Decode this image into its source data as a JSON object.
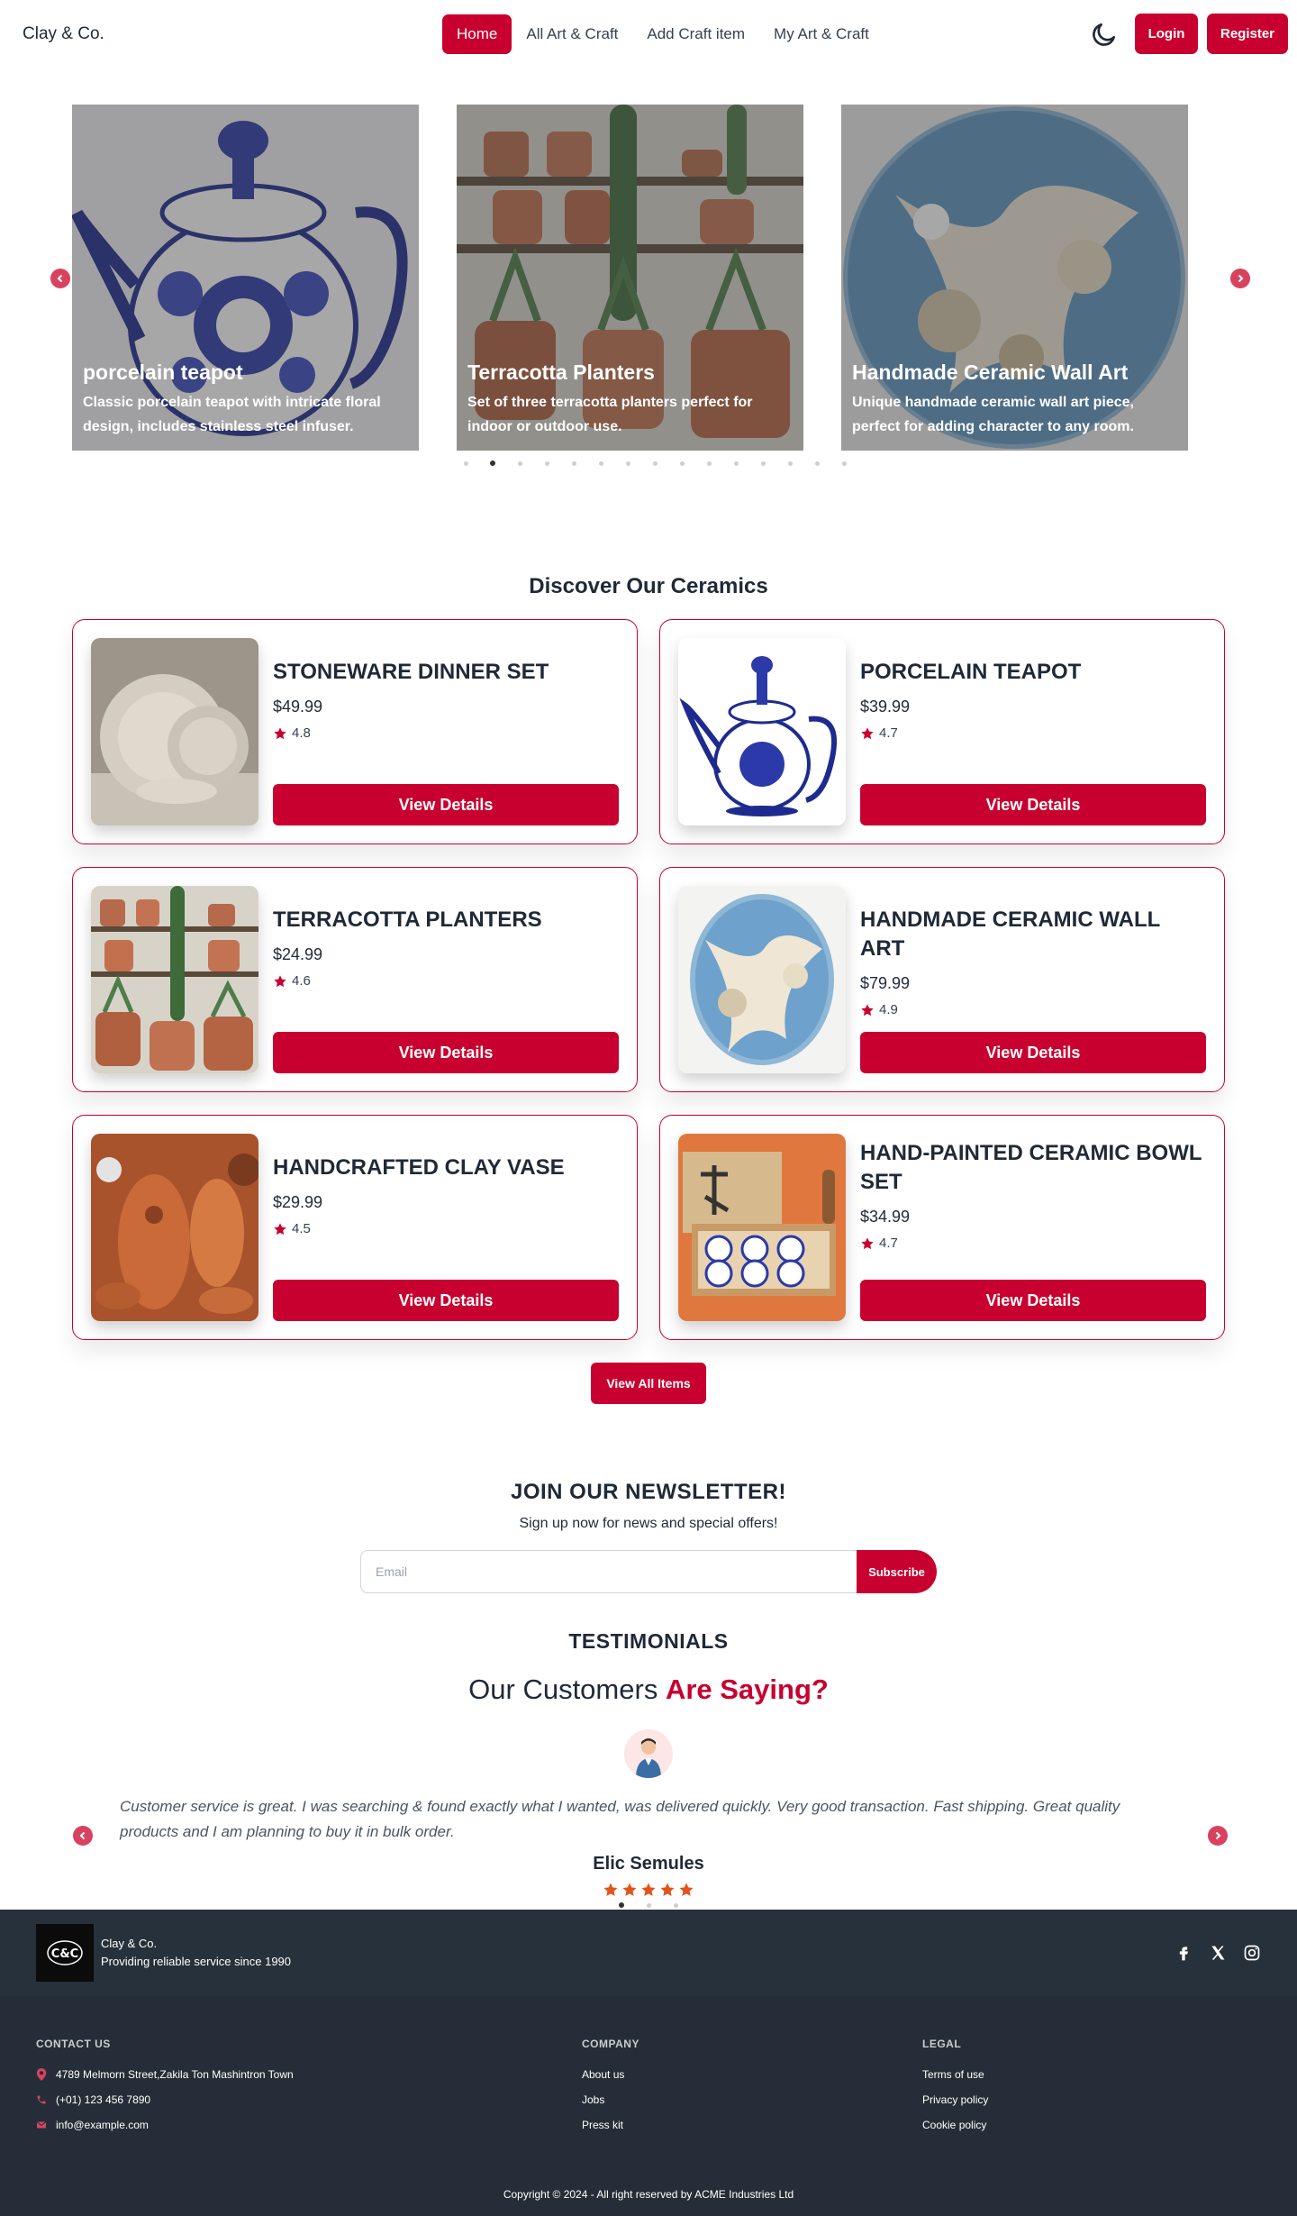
{
  "nav": {
    "brand": "Clay & Co.",
    "links": [
      "Home",
      "All Art & Craft",
      "Add Craft item",
      "My Art & Craft"
    ],
    "login": "Login",
    "register": "Register"
  },
  "carousel": {
    "slides": [
      {
        "title": "porcelain teapot",
        "desc": "Classic porcelain teapot with intricate floral design, includes stainless steel infuser."
      },
      {
        "title": "Terracotta Planters",
        "desc": "Set of three terracotta planters perfect for indoor or outdoor use."
      },
      {
        "title": "Handmade Ceramic Wall Art",
        "desc": "Unique handmade ceramic wall art piece, perfect for adding character to any room."
      }
    ],
    "dot_count": 15,
    "active_dot": 1
  },
  "ceramics": {
    "title": "Discover Our Ceramics",
    "items": [
      {
        "name": "STONEWARE DINNER SET",
        "price": "$49.99",
        "rating": "4.8",
        "button": "View Details"
      },
      {
        "name": "PORCELAIN TEAPOT",
        "price": "$39.99",
        "rating": "4.7",
        "button": "View Details"
      },
      {
        "name": "TERRACOTTA PLANTERS",
        "price": "$24.99",
        "rating": "4.6",
        "button": "View Details"
      },
      {
        "name": "HANDMADE CERAMIC WALL ART",
        "price": "$79.99",
        "rating": "4.9",
        "button": "View Details"
      },
      {
        "name": "HANDCRAFTED CLAY VASE",
        "price": "$29.99",
        "rating": "4.5",
        "button": "View Details"
      },
      {
        "name": "HAND-PAINTED CERAMIC BOWL SET",
        "price": "$34.99",
        "rating": "4.7",
        "button": "View Details"
      }
    ],
    "view_all": "View All Items"
  },
  "newsletter": {
    "title": "JOIN OUR NEWSLETTER!",
    "subtitle": "Sign up now for news and special offers!",
    "placeholder": "Email",
    "button": "Subscribe"
  },
  "testimonials": {
    "title": "TESTIMONIALS",
    "heading_plain": "Our Customers",
    "heading_accent": "Are Saying?",
    "quote": "Customer service is great. I was searching & found exactly what I wanted, was delivered quickly. Very good transaction. Fast shipping. Great quality products and I am planning to buy it in bulk order.",
    "name": "Elic Semules",
    "stars": 5,
    "dot_count": 3,
    "active_dot": 0
  },
  "footer": {
    "logo_text": "C&C",
    "company": "Clay & Co.",
    "tagline": "Providing reliable service since 1990",
    "contact": {
      "heading": "CONTACT US",
      "address": "4789 Melmorn Street,Zakila Ton Mashintron Town",
      "phone": "(+01) 123 456 7890",
      "email": "info@example.com"
    },
    "company_col": {
      "heading": "COMPANY",
      "links": [
        "About us",
        "Jobs",
        "Press kit"
      ]
    },
    "legal_col": {
      "heading": "LEGAL",
      "links": [
        "Terms of use",
        "Privacy policy",
        "Cookie policy"
      ]
    },
    "copyright": "Copyright © 2024 - All right reserved by ACME Industries Ltd"
  },
  "colors": {
    "accent": "#c8002f",
    "footer_top": "#27313b",
    "footer_bottom": "#252e38",
    "star": "#e2541b"
  }
}
